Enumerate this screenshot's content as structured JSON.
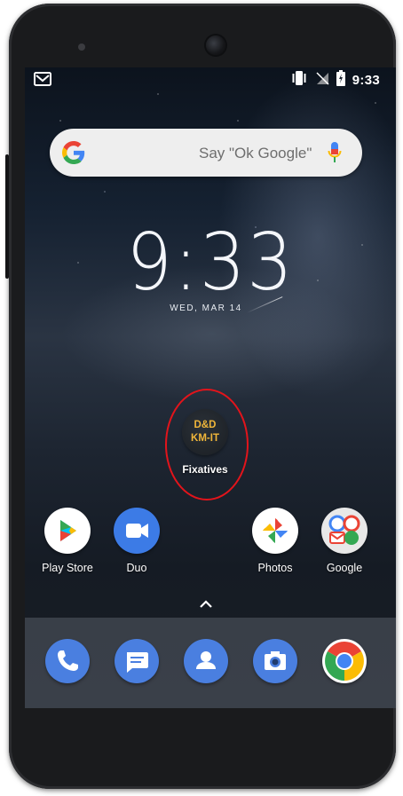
{
  "status_bar": {
    "notification_icon": "gmail-icon",
    "vibrate_icon": "vibrate-icon",
    "signal_icon": "no-sim-icon",
    "battery_icon": "battery-charging-icon",
    "time": "9:33"
  },
  "search": {
    "placeholder": "Say \"Ok Google\"",
    "logo_icon": "google-g-icon",
    "mic_icon": "mic-icon"
  },
  "clock": {
    "time": "9:33",
    "date": "WED, MAR 14"
  },
  "featured_app": {
    "icon_line1": "D&D",
    "icon_line2": "KM-IT",
    "label": "Fixatives",
    "highlight_color": "#e3141b"
  },
  "home_apps": [
    {
      "label": "Play Store",
      "icon": "play-store-icon"
    },
    {
      "label": "Duo",
      "icon": "duo-icon"
    },
    {
      "label": "Photos",
      "icon": "photos-icon"
    },
    {
      "label": "Google",
      "icon": "google-folder-icon"
    }
  ],
  "app_drawer_handle": "chevron-up-icon",
  "dock_apps": [
    {
      "name": "Phone",
      "icon": "phone-icon"
    },
    {
      "name": "Messages",
      "icon": "messages-icon"
    },
    {
      "name": "Contacts",
      "icon": "contacts-icon"
    },
    {
      "name": "Camera",
      "icon": "camera-icon"
    },
    {
      "name": "Chrome",
      "icon": "chrome-icon"
    }
  ],
  "colors": {
    "google_blue": "#4285F4",
    "google_red": "#EA4335",
    "google_yellow": "#FBBC05",
    "google_green": "#34A853",
    "dock_icon_blue": "#4a7fe0"
  }
}
